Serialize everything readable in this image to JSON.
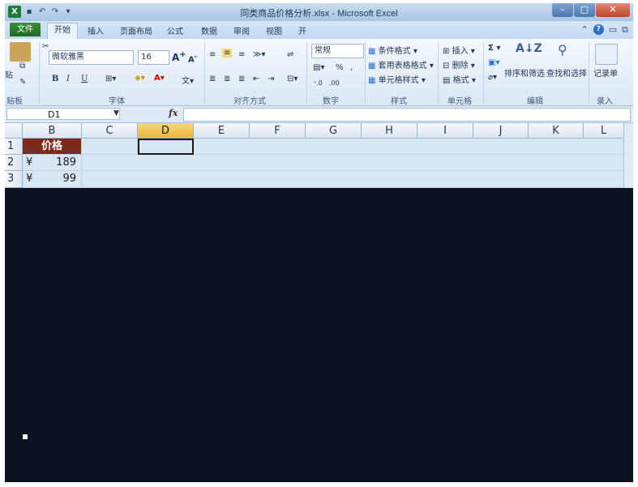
{
  "window": {
    "title": "同类商品价格分析.xlsx - Microsoft Excel",
    "app_icon": "X"
  },
  "tabs": [
    {
      "label": "文件"
    },
    {
      "label": "开始"
    },
    {
      "label": "插入"
    },
    {
      "label": "页面布局"
    },
    {
      "label": "公式"
    },
    {
      "label": "数据"
    },
    {
      "label": "审阅"
    },
    {
      "label": "视图"
    },
    {
      "label": "开"
    }
  ],
  "ribbon": {
    "clipboard": {
      "paste": "贴",
      "label": "贴板"
    },
    "font": {
      "name": "微软雅黑",
      "size": "16",
      "bold": "B",
      "italic": "I",
      "underline": "U",
      "label": "字体"
    },
    "alignment": {
      "label": "对齐方式"
    },
    "number": {
      "format": "常规",
      "percent": "%",
      "comma": ",",
      "label": "数字"
    },
    "styles": {
      "conditional": "条件格式",
      "table": "套用表格格式",
      "cell_styles": "单元格样式",
      "label": "样式"
    },
    "cells": {
      "insert": "插入",
      "delete": "删除",
      "format": "格式",
      "label": "单元格"
    },
    "editing": {
      "sort_filter": "排序和筛选",
      "find_select": "查找和选择",
      "label": "编辑"
    },
    "record": {
      "label": "记录单",
      "group": "录入"
    }
  },
  "formula_bar": {
    "name_box": "D1",
    "fx": "fx",
    "value": ""
  },
  "columns": [
    "B",
    "C",
    "D",
    "E",
    "F",
    "G",
    "H",
    "I",
    "J",
    "K",
    "L"
  ],
  "active_column": "D",
  "rows": [
    {
      "num": "1",
      "b": "价格"
    },
    {
      "num": "2",
      "currency": "¥",
      "value": "189"
    },
    {
      "num": "3",
      "currency": "¥",
      "value": "99"
    }
  ],
  "colors": {
    "header_fill": "#7a2b1a",
    "file_tab": "#1f6b24",
    "active_col": "#e9b73d"
  }
}
